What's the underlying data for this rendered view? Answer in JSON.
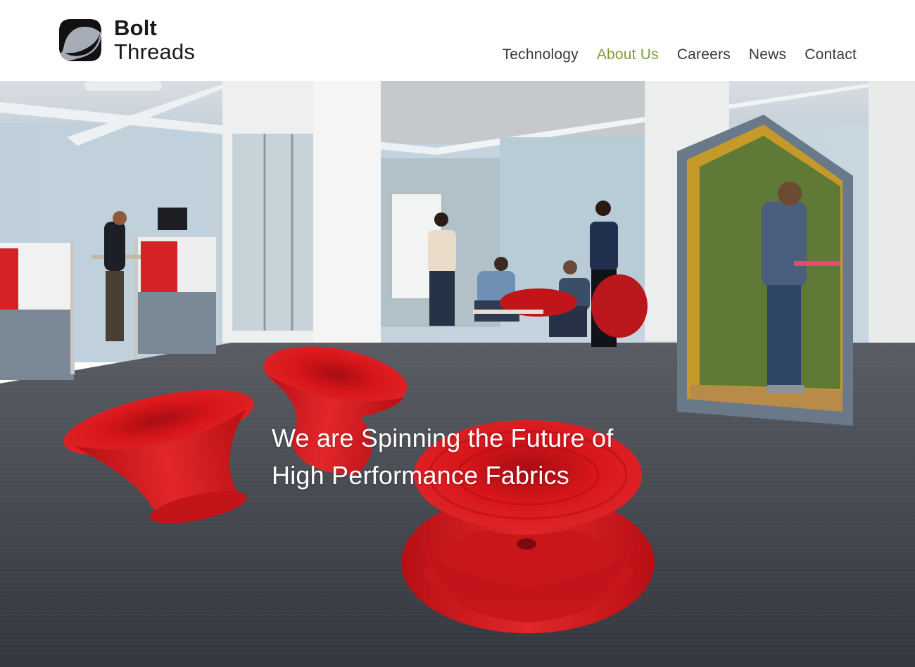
{
  "brand": {
    "word1": "Bolt",
    "word2": "Threads",
    "logo_icon": "bolt-threads-logo-icon"
  },
  "nav": {
    "items": [
      {
        "label": "Technology",
        "active": false
      },
      {
        "label": "About Us",
        "active": true
      },
      {
        "label": "Careers",
        "active": false
      },
      {
        "label": "News",
        "active": false
      },
      {
        "label": "Contact",
        "active": false
      }
    ]
  },
  "hero": {
    "headline_line1": "We are Spinning the Future of",
    "headline_line2": "High Performance Fabrics",
    "image": "office-interior-with-red-spun-chairs-photo"
  },
  "colors": {
    "accent": "#7e9b3a",
    "nav_text": "#3a3a3a",
    "chair_red": "#d8161b",
    "carpet": "#3d3f48",
    "booth_green": "#5e7a36"
  }
}
